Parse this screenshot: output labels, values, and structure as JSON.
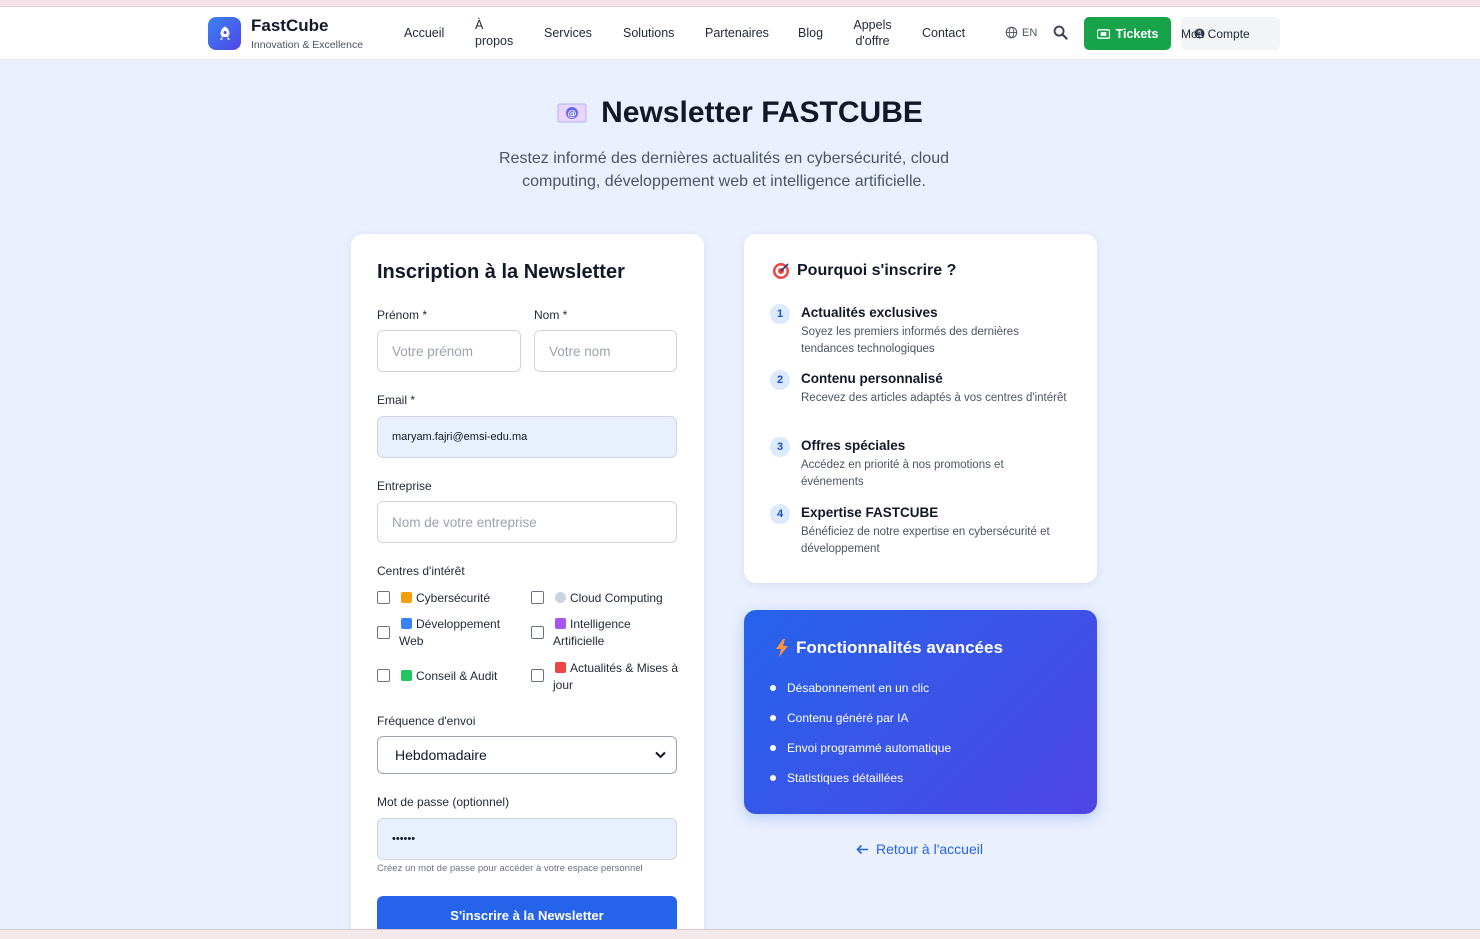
{
  "header": {
    "brand_name": "FastCube",
    "brand_tagline": "Innovation & Excellence",
    "nav": [
      "Accueil",
      "À propos",
      "Services",
      "Solutions",
      "Partenaires",
      "Blog",
      "Appels d'offre",
      "Contact"
    ],
    "lang": "EN",
    "tickets_label": "Tickets",
    "account_label": "Mon Compte"
  },
  "hero": {
    "title": "Newsletter FASTCUBE",
    "subtitle": "Restez informé des dernières actualités en cybersécurité, cloud computing, développement web et intelligence artificielle."
  },
  "form": {
    "title": "Inscription à la Newsletter",
    "first_name_label": "Prénom *",
    "first_name_placeholder": "Votre prénom",
    "last_name_label": "Nom *",
    "last_name_placeholder": "Votre nom",
    "email_label": "Email *",
    "email_value": "maryam.fajri@emsi-edu.ma",
    "company_label": "Entreprise",
    "company_placeholder": "Nom de votre entreprise",
    "interests_label": "Centres d'intérêt",
    "interests": [
      {
        "label": "Cybersécurité",
        "icon": "lock-icon",
        "color": "#f59e0b"
      },
      {
        "label": "Cloud Computing",
        "icon": "cloud-icon",
        "color": "#cbd5e1"
      },
      {
        "label": "Développement Web",
        "icon": "laptop-icon",
        "color": "#3b82f6"
      },
      {
        "label": "Intelligence Artificielle",
        "icon": "robot-icon",
        "color": "#a855f7"
      },
      {
        "label": "Conseil & Audit",
        "icon": "chart-icon",
        "color": "#22c55e"
      },
      {
        "label": "Actualités & Mises à jour",
        "icon": "megaphone-icon",
        "color": "#ef4444"
      }
    ],
    "frequency_label": "Fréquence d'envoi",
    "frequency_value": "Hebdomadaire",
    "password_label": "Mot de passe (optionnel)",
    "password_value": "••••••",
    "password_hint": "Créez un mot de passe pour accéder à votre espace personnel",
    "submit_label": "S'inscrire à la Newsletter"
  },
  "why": {
    "title": "Pourquoi s'inscrire ?",
    "items": [
      {
        "num": "1",
        "title": "Actualités exclusives",
        "desc": "Soyez les premiers informés des dernières tendances technologiques"
      },
      {
        "num": "2",
        "title": "Contenu personnalisé",
        "desc": "Recevez des articles adaptés à vos centres d'intérêt"
      },
      {
        "num": "3",
        "title": "Offres spéciales",
        "desc": "Accédez en priorité à nos promotions et événements"
      },
      {
        "num": "4",
        "title": "Expertise FASTCUBE",
        "desc": "Bénéficiez de notre expertise en cybersécurité et développement"
      }
    ]
  },
  "features": {
    "title": "Fonctionnalités avancées",
    "items": [
      "Désabonnement en un clic",
      "Contenu généré par IA",
      "Envoi programmé automatique",
      "Statistiques détaillées"
    ]
  },
  "back_link": "Retour à l'accueil",
  "colors": {
    "primary": "#2563eb",
    "success": "#16a34a",
    "background": "#eaf0fd"
  }
}
